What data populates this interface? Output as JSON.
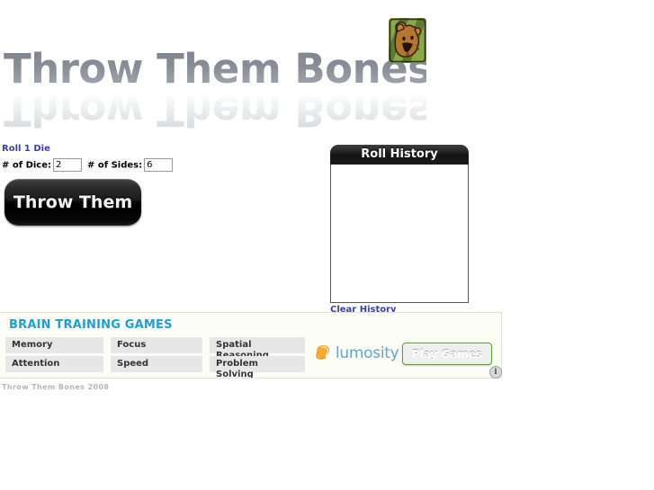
{
  "header": {
    "title": "Throw Them Bones",
    "logo_alt": "dog-head-logo"
  },
  "controls": {
    "roll_one_die_link": "Roll 1 Die",
    "dice_label": "# of Dice:",
    "dice_value": "2",
    "sides_label": "# of Sides:",
    "sides_value": "6",
    "throw_button": "Throw Them"
  },
  "history": {
    "title": "Roll History",
    "entries": "",
    "clear_link": "Clear History"
  },
  "ad": {
    "heading": "BRAIN TRAINING GAMES",
    "columns": [
      [
        "Memory",
        "Attention"
      ],
      [
        "Focus",
        "Speed"
      ],
      [
        "Spatial Reasoning",
        "Problem Solving"
      ]
    ],
    "logo_text": "lumosity",
    "cta_label": "Play Games",
    "adchoices_icon": "info-icon",
    "adchoices_glyph": "i"
  },
  "footer": {
    "copyright": "Throw Them Bones 2008"
  },
  "colors": {
    "title_gray": "#8b9099",
    "link_blue": "#3b3bb7",
    "ad_heading_blue": "#1a9fdc",
    "lumosity_blue": "#5aa8d8",
    "cta_green": "#6db22f",
    "footer_gray": "#b6b6b6",
    "panel_black": "#141414"
  }
}
